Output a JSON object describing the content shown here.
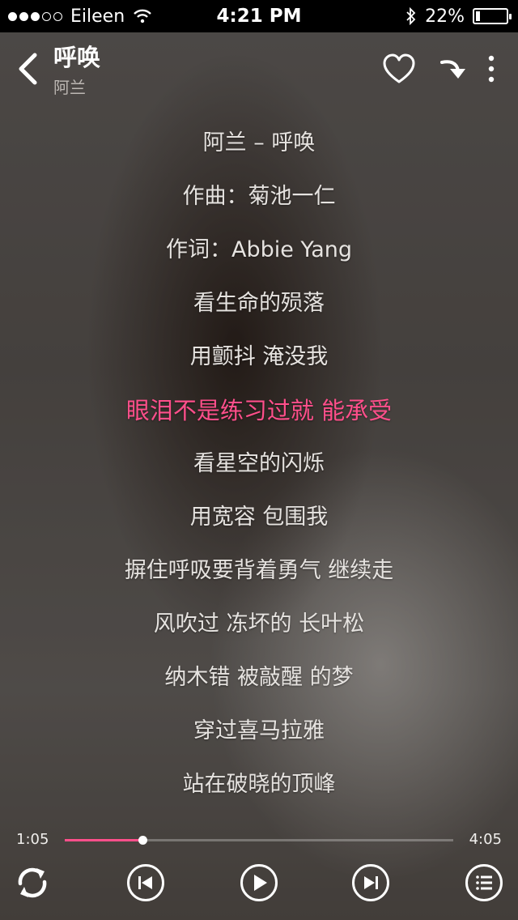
{
  "status_bar": {
    "carrier": "Eileen",
    "time": "4:21 PM",
    "battery": "22%",
    "battery_level": 0.22
  },
  "header": {
    "title": "呼唤",
    "artist": "阿兰"
  },
  "lyrics": {
    "lines": [
      "阿兰 – 呼唤",
      "作曲：菊池一仁",
      "作词：Abbie Yang",
      "看生命的殒落",
      "用颤抖 淹没我",
      "眼泪不是练习过就 能承受",
      "看星空的闪烁",
      "用宽容 包围我",
      "摒住呼吸要背着勇气 继续走",
      "风吹过 冻坏的 长叶松",
      "纳木错 被敲醒 的梦",
      "穿过喜马拉雅",
      "站在破晓的顶峰"
    ],
    "current_index": 5
  },
  "player": {
    "elapsed": "1:05",
    "duration": "4:05",
    "progress": 0.2
  },
  "colors": {
    "accent": "#ff4f8b"
  },
  "icons": {
    "back": "chevron-left-icon",
    "favorite": "heart-icon",
    "download": "download-arrow-icon",
    "more": "more-vertical-icon",
    "repeat": "repeat-icon",
    "previous": "previous-icon",
    "play": "play-icon",
    "next": "next-icon",
    "playlist": "playlist-icon"
  }
}
